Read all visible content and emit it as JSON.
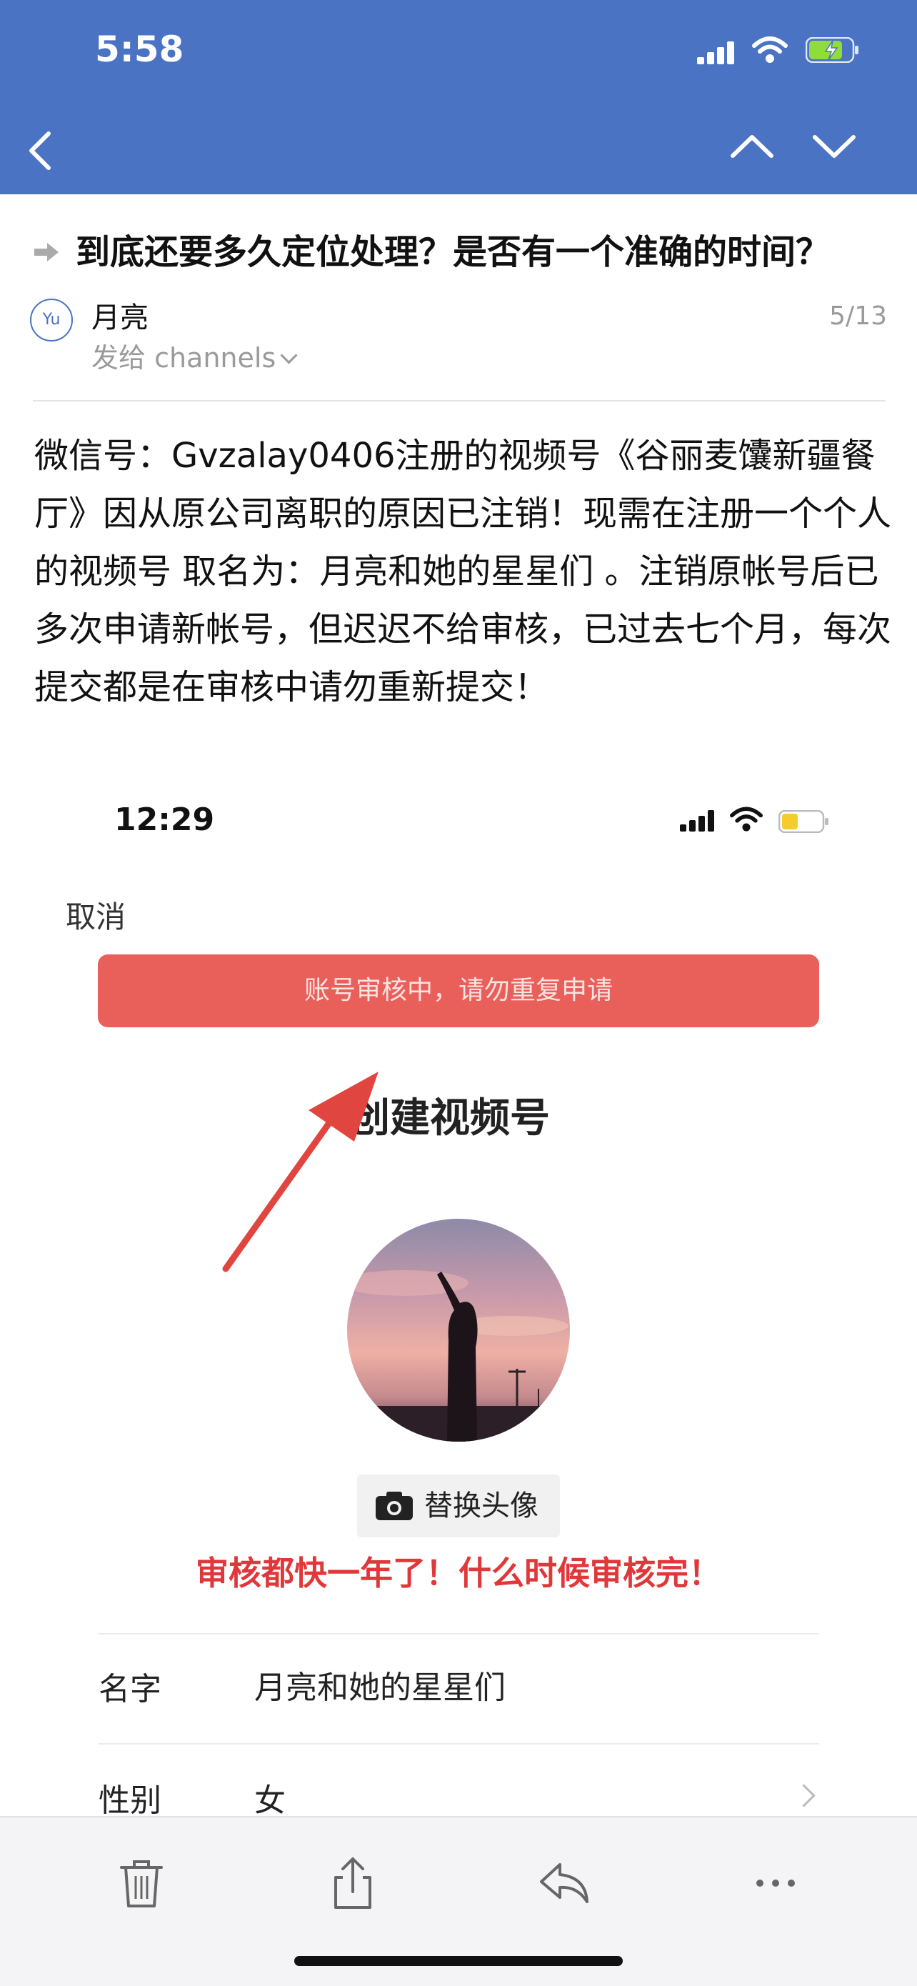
{
  "status_bar": {
    "time": "5:58"
  },
  "nav": {
    "back_icon": "chevron-left-icon",
    "prev_icon": "chevron-up-icon",
    "next_icon": "chevron-down-icon"
  },
  "mail": {
    "subject": "到底还要多久定位处理？是否有一个准确的时间？",
    "avatar_text": "Yu",
    "sender": "月亮",
    "to_line": "发给 channels",
    "date": "5/13",
    "body": "微信号：Gvzalay0406注册的视频号《谷丽麦馕新疆餐厅》因从原公司离职的原因已注销！现需在注册一个个人的视频号 取名为：月亮和她的星星们 。注销原帐号后已多次申请新帐号，但迟迟不给审核，已过去七个月，每次提交都是在审核中请勿重新提交！"
  },
  "embedded_screenshot": {
    "time": "12:29",
    "cancel": "取消",
    "alert": "账号审核中，请勿重复申请",
    "title": "创建视频号",
    "replace_avatar": "替换头像",
    "annotation": "审核都快一年了！什么时候审核完！",
    "rows": [
      {
        "label": "名字",
        "value": "月亮和她的星星们"
      },
      {
        "label": "性别",
        "value": "女"
      }
    ]
  },
  "toolbar": {
    "icons": [
      "trash-icon",
      "share-icon",
      "reply-icon",
      "more-icon"
    ]
  },
  "colors": {
    "header": "#4a73c4",
    "alert": "#e9605b",
    "annotation": "#e0383a",
    "battery": "#8fdc3a"
  }
}
